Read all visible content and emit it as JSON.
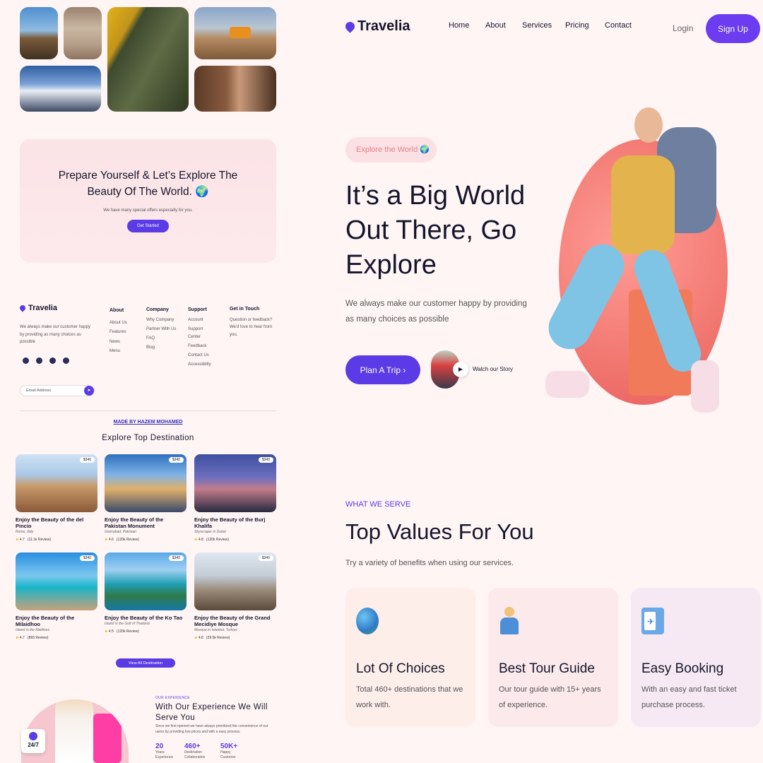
{
  "brand": {
    "name": "Travelia"
  },
  "nav": {
    "items": [
      "Home",
      "About",
      "Services",
      "Pricing",
      "Contact"
    ],
    "login": "Login",
    "signup": "Sign Up"
  },
  "hero": {
    "pill": "Explore the World 🌍",
    "title": "It’s a Big World Out There, Go Explore",
    "subtitle": "We always make our customer happy by providing as many choices as possible",
    "plan_button": "Plan A Trip  ›",
    "watch": "Watch our Story"
  },
  "serve": {
    "eyebrow": "WHAT WE SERVE",
    "title": "Top Values For You",
    "subtitle": "Try a variety of benefits when using our services.",
    "cards": [
      {
        "title": "Lot Of Choices",
        "text": "Total 460+ destinations that we work with.",
        "icon": "globe-icon",
        "bg": "#fdeeea"
      },
      {
        "title": "Best Tour Guide",
        "text": "Our tour guide with 15+ years of experience.",
        "icon": "guide-icon",
        "bg": "#fbe9ec"
      },
      {
        "title": "Easy Booking",
        "text": "With an easy and fast ticket purchase process.",
        "icon": "ticket-icon",
        "bg": "#f6e9f4"
      }
    ]
  },
  "cta": {
    "title": "Prepare Yourself & Let’s Explore The Beauty Of The World. 🌍",
    "subtitle": "We have many special offers especially for you.",
    "button": "Get Started"
  },
  "footer": {
    "about": "We always make our customer happy by providing as many choices as possible",
    "cols": [
      {
        "title": "About",
        "items": [
          "About Us",
          "Features",
          "News",
          "Menu"
        ]
      },
      {
        "title": "Company",
        "items": [
          "Why Company",
          "Partner With Us",
          "FAQ",
          "Blog"
        ]
      },
      {
        "title": "Support",
        "items": [
          "Account",
          "Support Center",
          "Feedback",
          "Contact Us",
          "Accessibility"
        ]
      },
      {
        "title": "Get in Touch",
        "items": [
          "Question or feedback? We'd love to hear from you."
        ]
      }
    ],
    "email_placeholder": "Email Address",
    "made_by": "MADE BY HAZEM MOHAMED"
  },
  "destinations": {
    "title": "Explore Top Destination",
    "view_all": "View All Destination",
    "items": [
      {
        "price": "$340",
        "title": "Enjoy the Beauty of the del Pincio",
        "sub": "Rome, Italy",
        "rating": "4.7",
        "reviews": "(11.1k Review)"
      },
      {
        "price": "$340",
        "title": "Enjoy the Beauty of the Pakistan Monument",
        "sub": "Islamabad, Pakistan",
        "rating": "4.6",
        "reviews": "(120k Review)"
      },
      {
        "price": "$340",
        "title": "Enjoy the Beauty of the Burj Khalifa",
        "sub": "Skyscraper in Dubai",
        "rating": "4.8",
        "reviews": "(120k Review)"
      },
      {
        "price": "$340",
        "title": "Enjoy the Beauty of the Milaidhoo",
        "sub": "Island in the Maldives",
        "rating": "4.7",
        "reviews": "(865 Review)"
      },
      {
        "price": "$340",
        "title": "Enjoy the Beauty of the Ko Tao",
        "sub": "Island in the Gulf of Thailand",
        "rating": "4.5",
        "reviews": "(120k Review)"
      },
      {
        "price": "$340",
        "title": "Enjoy the Beauty of the Grand Mecidiye Mosque",
        "sub": "Mosque in Istanbul, Turkiye",
        "rating": "4.8",
        "reviews": "(29.5k Review)"
      }
    ]
  },
  "experience": {
    "eyebrow": "OUR EXPERIENCE",
    "title": "With Our Experience We Will Serve You",
    "text": "Since we first opened we have always prioritized the convenience of our users by providing low prices and with a easy process.",
    "badge": "24/7",
    "stats": [
      {
        "value": "20",
        "label": "Years Experience"
      },
      {
        "value": "460+",
        "label": "Destination Collaboration"
      },
      {
        "value": "50K+",
        "label": "Happy Customer"
      }
    ]
  },
  "colors": {
    "primary": "#5b3be6",
    "background": "#fff5f5",
    "accent_pink": "#e67f8c"
  }
}
